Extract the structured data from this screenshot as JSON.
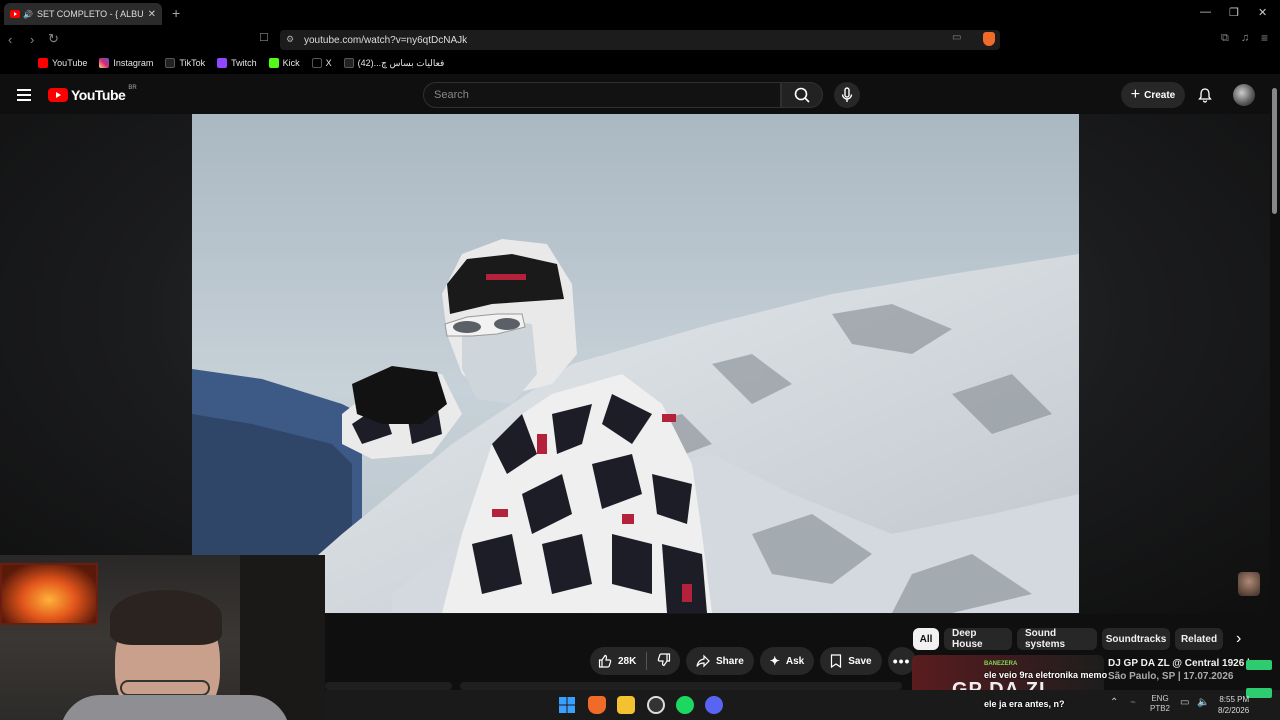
{
  "browser": {
    "tab_title": "SET COMPLETO - { ALBUM M",
    "url": "youtube.com/watch?v=ny6qtDcNAJk",
    "bookmarks": [
      {
        "label": "YouTube",
        "color": "#ff0000"
      },
      {
        "label": "Instagram",
        "color": "#d6249f"
      },
      {
        "label": "TikTok",
        "color": "#222222"
      },
      {
        "label": "Twitch",
        "color": "#9146ff"
      },
      {
        "label": "Kick",
        "color": "#53fc18"
      },
      {
        "label": "X",
        "color": "#000000"
      },
      {
        "label": "فعالیات بساس چ...(42)",
        "color": "#222222"
      }
    ]
  },
  "youtube": {
    "logo_text": "YouTube",
    "country_code": "BR",
    "search_placeholder": "Search",
    "create_label": "Create"
  },
  "actions": {
    "likes": "28K",
    "share": "Share",
    "ask": "Ask",
    "save": "Save"
  },
  "chips": [
    "All",
    "Deep House",
    "Sound systems",
    "Soundtracks",
    "Related"
  ],
  "related": {
    "title": "DJ GP DA ZL @ Central 1926 |",
    "subtitle": "São Paulo, SP | 17.07.2026"
  },
  "chat": [
    {
      "user": "BANEZERA",
      "message": "ele veio 9ra eletronika memo"
    },
    {
      "user": "",
      "message": "ele ja era antes, n?"
    }
  ],
  "taskbar": {
    "lang": "ENG",
    "layout": "PTB2",
    "time": "8:55 PM",
    "date": "8/2/2026"
  },
  "colors": {
    "accent": "#ff0000",
    "background": "#0f0f0f",
    "chip_bg": "#272727"
  }
}
